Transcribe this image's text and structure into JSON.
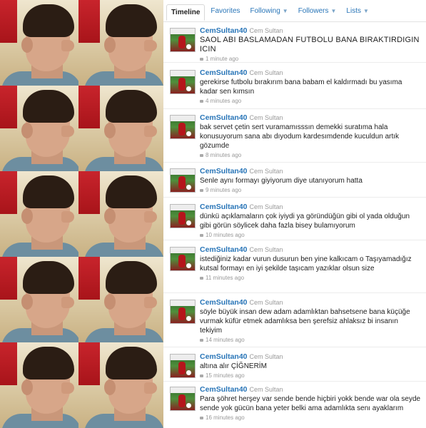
{
  "tabs": [
    {
      "label": "Timeline",
      "active": true,
      "dropdown": false
    },
    {
      "label": "Favorites",
      "active": false,
      "dropdown": false
    },
    {
      "label": "Following",
      "active": false,
      "dropdown": true
    },
    {
      "label": "Followers",
      "active": false,
      "dropdown": true
    },
    {
      "label": "Lists",
      "active": false,
      "dropdown": true
    }
  ],
  "tweets": [
    {
      "username": "CemSultan40",
      "name": "Cem Sultan",
      "text": "SAOL ABI BASLAMADAN FUTBOLU BANA BIRAKTIRDIGIN ICIN",
      "time": "1 minute ago"
    },
    {
      "username": "CemSultan40",
      "name": "Cem Sultan",
      "text": "gerekirse futbolu bırakırım bana babam el kaldırmadı bu yasıma kadar sen kımsın",
      "time": "4 minutes ago"
    },
    {
      "username": "CemSultan40",
      "name": "Cem Sultan",
      "text": "bak servet çetin sert vuramamısssın demekki suratıma hala konusuyorum sana abı dıyodum kardesımdende kuculdun artık gözumde",
      "time": "8 minutes ago"
    },
    {
      "username": "CemSultan40",
      "name": "Cem Sultan",
      "text": "Senle aynı formayı giyiyorum diye utanıyorum hatta",
      "time": "9 minutes ago"
    },
    {
      "username": "CemSultan40",
      "name": "Cem Sultan",
      "text": "dünkü açıklamaların çok iyiydi ya göründüğün gibi ol yada olduğun gibi görün söylicek daha fazla bisey bulamıyorum",
      "time": "10 minutes ago"
    },
    {
      "username": "CemSultan40",
      "name": "Cem Sultan",
      "text": "istediğiniz kadar vurun dusurun ben yine kalkıcam o Taşıyamadığız kutsal formayı en iyi şekilde taşıcam yazıklar olsun size",
      "time": "11 minutes ago"
    },
    {
      "username": "CemSultan40",
      "name": "Cem Sultan",
      "text": "söyle büyük insan dew adam adamlıktan bahsetsene bana küçüğe vurmak küfür etmek adamlıksa ben şerefsiz ahlaksız bi insanın tekiyim",
      "time": "14 minutes ago"
    },
    {
      "username": "CemSultan40",
      "name": "Cem Sultan",
      "text": "altına alır ÇİĞNERİM",
      "time": "15 minutes ago"
    },
    {
      "username": "CemSultan40",
      "name": "Cem Sultan",
      "text": "Para şöhret herşey var sende bende hiçbiri yokk bende war ola seyde sende yok gücün bana yeter belki ama adamlıkta senı ayaklarım",
      "time": "16 minutes ago"
    }
  ],
  "colors": {
    "link": "#2a76b8",
    "meta": "#999999",
    "text": "#222222"
  }
}
